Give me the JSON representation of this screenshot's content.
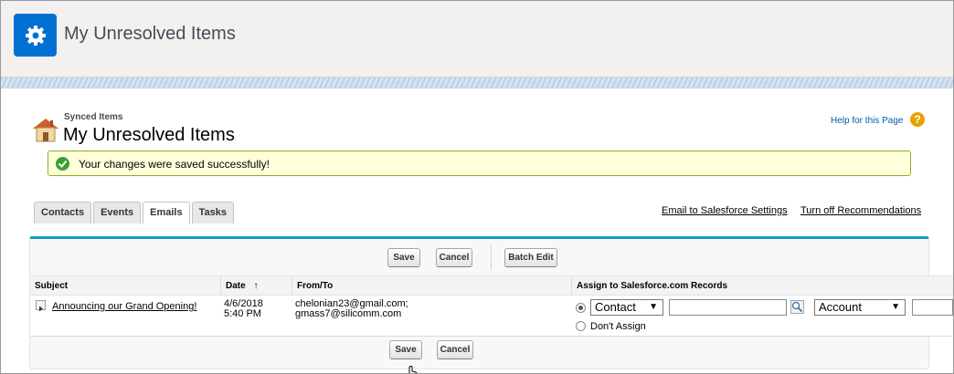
{
  "header": {
    "title": "My Unresolved Items",
    "icon": "gear-icon",
    "accent": "#0070d2"
  },
  "page": {
    "breadcrumb": "Synced Items",
    "title": "My Unresolved Items",
    "help_link": "Help for this Page",
    "help_icon": "question-icon",
    "success_message": "Your changes were saved successfully!"
  },
  "tabs": [
    {
      "label": "Contacts",
      "active": false
    },
    {
      "label": "Events",
      "active": false
    },
    {
      "label": "Emails",
      "active": true
    },
    {
      "label": "Tasks",
      "active": false
    }
  ],
  "links": {
    "email_settings": "Email to Salesforce Settings",
    "turn_off": "Turn off Recommendations"
  },
  "toolbar": {
    "save": "Save",
    "cancel": "Cancel",
    "batch_edit": "Batch Edit"
  },
  "table": {
    "columns": [
      "Subject",
      "Date",
      "From/To",
      "Assign to Salesforce.com Records"
    ],
    "sort_indicator": "↑",
    "rows": [
      {
        "subject": "Announcing our Grand Opening!",
        "date_line1": "4/6/2018",
        "date_line2": "5:40 PM",
        "from_line1": "chelonian23@gmail.com;",
        "from_line2": "gmass7@silicomm.com",
        "assign_type": "Contact",
        "assign_account": "Account",
        "dont_assign": "Don't Assign"
      }
    ]
  },
  "footer_toolbar": {
    "save": "Save",
    "cancel": "Cancel"
  },
  "colors": {
    "success_border": "#8db022",
    "success_bg": "#ffffdc",
    "panel_accent": "#1797c0"
  }
}
